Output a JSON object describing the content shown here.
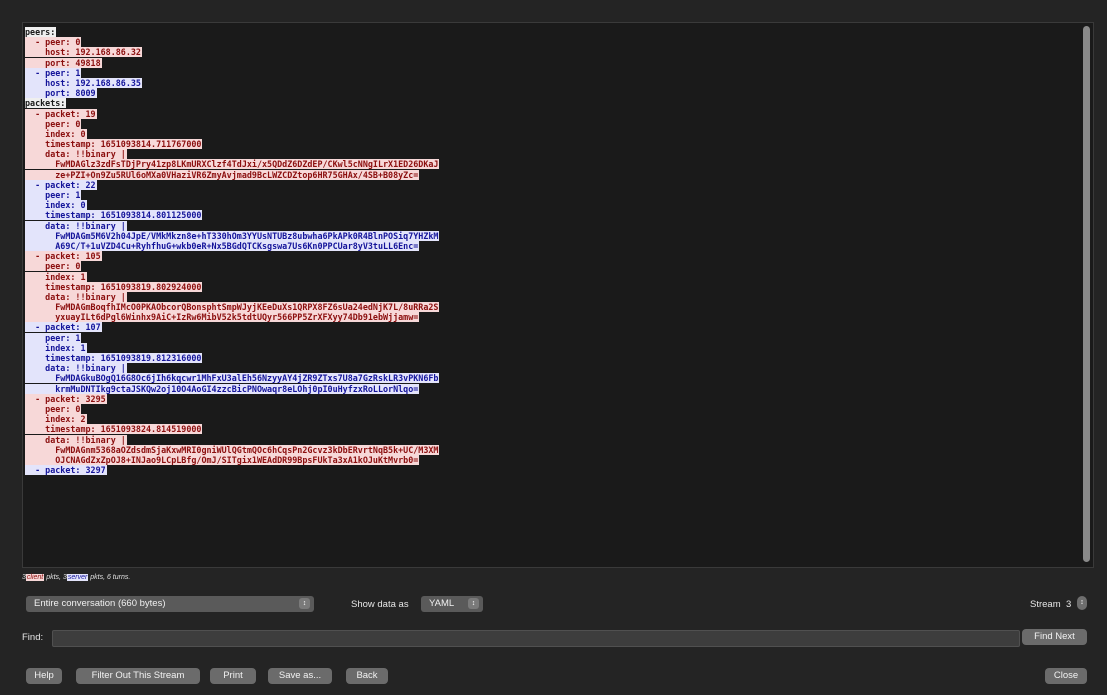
{
  "stream_lines": [
    {
      "t": "peers:",
      "k": "hd"
    },
    {
      "t": "  - peer: 0",
      "k": "c"
    },
    {
      "t": "    host: 192.168.86.32",
      "k": "c"
    },
    {
      "t": "    port: 49818",
      "k": "c"
    },
    {
      "t": "  - peer: 1",
      "k": "s"
    },
    {
      "t": "    host: 192.168.86.35",
      "k": "s"
    },
    {
      "t": "    port: 8009",
      "k": "s"
    },
    {
      "t": "packets:",
      "k": "hd"
    },
    {
      "t": "  - packet: 19",
      "k": "c"
    },
    {
      "t": "    peer: 0",
      "k": "c"
    },
    {
      "t": "    index: 0",
      "k": "c"
    },
    {
      "t": "    timestamp: 1651093814.711767000",
      "k": "c"
    },
    {
      "t": "    data: !!binary |",
      "k": "c"
    },
    {
      "t": "      FwMDAGlz3zdFsTDjPry41zp8LKmURXClzf4TdJxi/x5QDdZ6DZdEP/CKwl5cNNgILrX1ED26DKaJ",
      "k": "c"
    },
    {
      "t": "      ze+PZI+On9Zu5RUl6oMXa0VHaziVR6ZmyAvjmad9BcLWZCDZtop6HR75GHAx/4SB+B08yZc=",
      "k": "c"
    },
    {
      "t": "  - packet: 22",
      "k": "s"
    },
    {
      "t": "    peer: 1",
      "k": "s"
    },
    {
      "t": "    index: 0",
      "k": "s"
    },
    {
      "t": "    timestamp: 1651093814.801125000",
      "k": "s"
    },
    {
      "t": "    data: !!binary |",
      "k": "s"
    },
    {
      "t": "      FwMDAGm5M6V2h04JpE/VMkMkzn8e+hT330hOm3YYUsNTUBz8ubwha6PkAPk0R4BlnPOSiq7YHZkM",
      "k": "s"
    },
    {
      "t": "      A69C/T+1uVZD4Cu+RyhfhuG+wkb0eR+Nx5BGdQTCKsgswa7Us6Kn0PPCUar8yV3tuLL6Enc=",
      "k": "s"
    },
    {
      "t": "  - packet: 105",
      "k": "c"
    },
    {
      "t": "    peer: 0",
      "k": "c"
    },
    {
      "t": "    index: 1",
      "k": "c"
    },
    {
      "t": "    timestamp: 1651093819.802924000",
      "k": "c"
    },
    {
      "t": "    data: !!binary |",
      "k": "c"
    },
    {
      "t": "      FwMDAGmBoqfhIMcO0PKAObcorQBonsphtSmpWJyjKEeDuXs1QRPX8FZ6sUa24edNjK7L/8uRRa2S",
      "k": "c"
    },
    {
      "t": "      yxuayILt6dPgl6Winhx9AiC+IzRw6MibV52k5tdtUQyr566PP5ZrXFXyy74Db91ebWjjamw=",
      "k": "c"
    },
    {
      "t": "  - packet: 107",
      "k": "s"
    },
    {
      "t": "    peer: 1",
      "k": "s"
    },
    {
      "t": "    index: 1",
      "k": "s"
    },
    {
      "t": "    timestamp: 1651093819.812316000",
      "k": "s"
    },
    {
      "t": "    data: !!binary |",
      "k": "s"
    },
    {
      "t": "      FwMDAGkuBOgQ16G8Oc6jIh6kqcwr1MhFxU3alEh56NzyyAY4jZR9ZTxs7U8a7GzRskLR3vPKN6Fb",
      "k": "s"
    },
    {
      "t": "      krmMuDNTIkg9ctaJSKQw2oj10O4AoGI4zzcBicPNOwaqr8eLOhj0pI0uHyfzxRoLLorNlqo=",
      "k": "s"
    },
    {
      "t": "  - packet: 3295",
      "k": "c"
    },
    {
      "t": "    peer: 0",
      "k": "c"
    },
    {
      "t": "    index: 2",
      "k": "c"
    },
    {
      "t": "    timestamp: 1651093824.814519000",
      "k": "c"
    },
    {
      "t": "    data: !!binary |",
      "k": "c"
    },
    {
      "t": "      FwMDAGnm5368aOZdsdmSjaKxwMRI0gniWUlQGtmQOc6hCqsPn2Gcvz3kDbERvrtNqB5k+UC/M3XM",
      "k": "c"
    },
    {
      "t": "      OJCNAGdZxZpOJ8+INJao9LCpLBfg/OmJ/SITgix1WEAdDR99BpsFUkTa3xA1kOJuKtMvrb0=",
      "k": "c"
    },
    {
      "t": "  - packet: 3297",
      "k": "s"
    }
  ],
  "summary": {
    "client_count": "3",
    "client_tag": "client",
    "client_suffix": " pkts, ",
    "server_count": "3",
    "server_tag": "server",
    "server_suffix": " pkts, 6 turns."
  },
  "controls": {
    "conversation_select": "Entire conversation (660 bytes)",
    "show_data_label": "Show data as",
    "format_select": "YAML",
    "stream_label": "Stream",
    "stream_value": "3",
    "find_label": "Find:",
    "find_value": "",
    "find_next": "Find Next"
  },
  "buttons": {
    "help": "Help",
    "filter_out": "Filter Out This Stream",
    "print": "Print",
    "save_as": "Save as...",
    "back": "Back",
    "close": "Close"
  },
  "icons": {
    "select_chevron": "up-down-chevron-icon",
    "stepper": "stepper-icon"
  },
  "colors": {
    "client_bg": "#f7d8d8",
    "client_fg": "#8b0e0e",
    "server_bg": "#e3e4fb",
    "server_fg": "#14149a"
  }
}
